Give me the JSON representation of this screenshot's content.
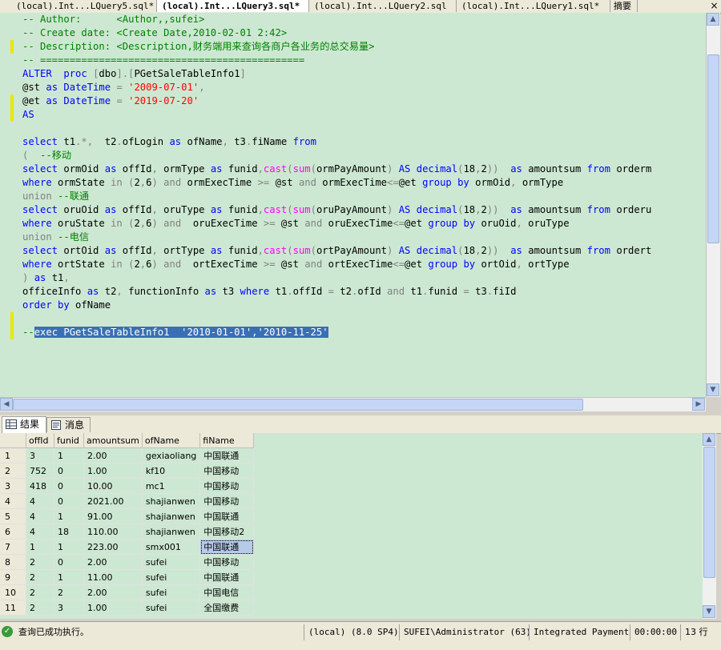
{
  "tabs": [
    {
      "label": "(local).Int...LQuery5.sql*",
      "active": false
    },
    {
      "label": "(local).Int...LQuery3.sql*",
      "active": true
    },
    {
      "label": "(local).Int...LQuery2.sql",
      "active": false
    },
    {
      "label": "(local).Int...LQuery1.sql*",
      "active": false
    },
    {
      "label": "摘要",
      "active": false
    }
  ],
  "close_glyph": "×",
  "editor": {
    "lines": [
      "-- Author:      <Author,,sufei>",
      "-- Create date: <Create Date,2010-02-01 2:42>",
      "-- Description: <Description,财务端用来查询各商户各业务的总交易量>",
      "-- =============================================",
      "ALTER  proc [dbo].[PGetSaleTableInfo1]",
      "@st as DateTime = '2009-07-01',",
      "@et as DateTime = '2019-07-20'",
      "AS",
      "",
      "select t1.*,  t2.ofLogin as ofName, t3.fiName from",
      "(  --移动",
      "select ormOid as offId, ormType as funid,cast(sum(ormPayAmount) AS decimal(18,2))  as amountsum from orderm",
      "where ormState in (2,6) and ormExecTime >= @st and ormExecTime<=@et group by ormOid, ormType",
      "union --联通",
      "select oruOid as offId, oruType as funid,cast(sum(oruPayAmount) AS decimal(18,2))  as amountsum from orderu",
      "where oruState in (2,6) and  oruExecTime >= @st and oruExecTime<=@et group by oruOid, oruType",
      "union --电信",
      "select ortOid as offId, ortType as funid,cast(sum(ortPayAmount) AS decimal(18,2))  as amountsum from ordert",
      "where ortState in (2,6) and  ortExecTime >= @st and ortExecTime<=@et group by ortOid, ortType",
      ") as t1,",
      "officeInfo as t2, functionInfo as t3 where t1.offId = t2.ofId and t1.funid = t3.fiId",
      "order by ofName",
      "",
      "--exec PGetSaleTableInfo1  '2010-01-01','2010-11-25'"
    ]
  },
  "result_tabs": [
    {
      "label": "结果",
      "active": true
    },
    {
      "label": "消息",
      "active": false
    }
  ],
  "grid": {
    "columns": [
      "",
      "offId",
      "funid",
      "amountsum",
      "ofName",
      "fiName"
    ],
    "rows": [
      [
        "1",
        "3",
        "1",
        "2.00",
        "gexiaoliang",
        "中国联通"
      ],
      [
        "2",
        "752",
        "0",
        "1.00",
        "kf10",
        "中国移动"
      ],
      [
        "3",
        "418",
        "0",
        "10.00",
        "mc1",
        "中国移动"
      ],
      [
        "4",
        "4",
        "0",
        "2021.00",
        "shajianwen",
        "中国移动"
      ],
      [
        "5",
        "4",
        "1",
        "91.00",
        "shajianwen",
        "中国联通"
      ],
      [
        "6",
        "4",
        "18",
        "110.00",
        "shajianwen",
        "中国移动2"
      ],
      [
        "7",
        "1",
        "1",
        "223.00",
        "smx001",
        "中国联通"
      ],
      [
        "8",
        "2",
        "0",
        "2.00",
        "sufei",
        "中国移动"
      ],
      [
        "9",
        "2",
        "1",
        "11.00",
        "sufei",
        "中国联通"
      ],
      [
        "10",
        "2",
        "2",
        "2.00",
        "sufei",
        "中国电信"
      ],
      [
        "11",
        "2",
        "3",
        "1.00",
        "sufei",
        "全国缴费"
      ]
    ]
  },
  "status": {
    "message": "查询已成功执行。",
    "server": "(local) (8.0 SP4)",
    "user": "SUFEI\\Administrator (63)",
    "database": "Integrated Payment",
    "elapsed": "00:00:00",
    "rows": "13 行"
  },
  "colors": {
    "editor_bg": "#cde8d2",
    "keyword": "#0000ff",
    "comment": "#008000",
    "string": "#ff0000",
    "function": "#ff00ff",
    "selection": "#3a6fb5"
  }
}
